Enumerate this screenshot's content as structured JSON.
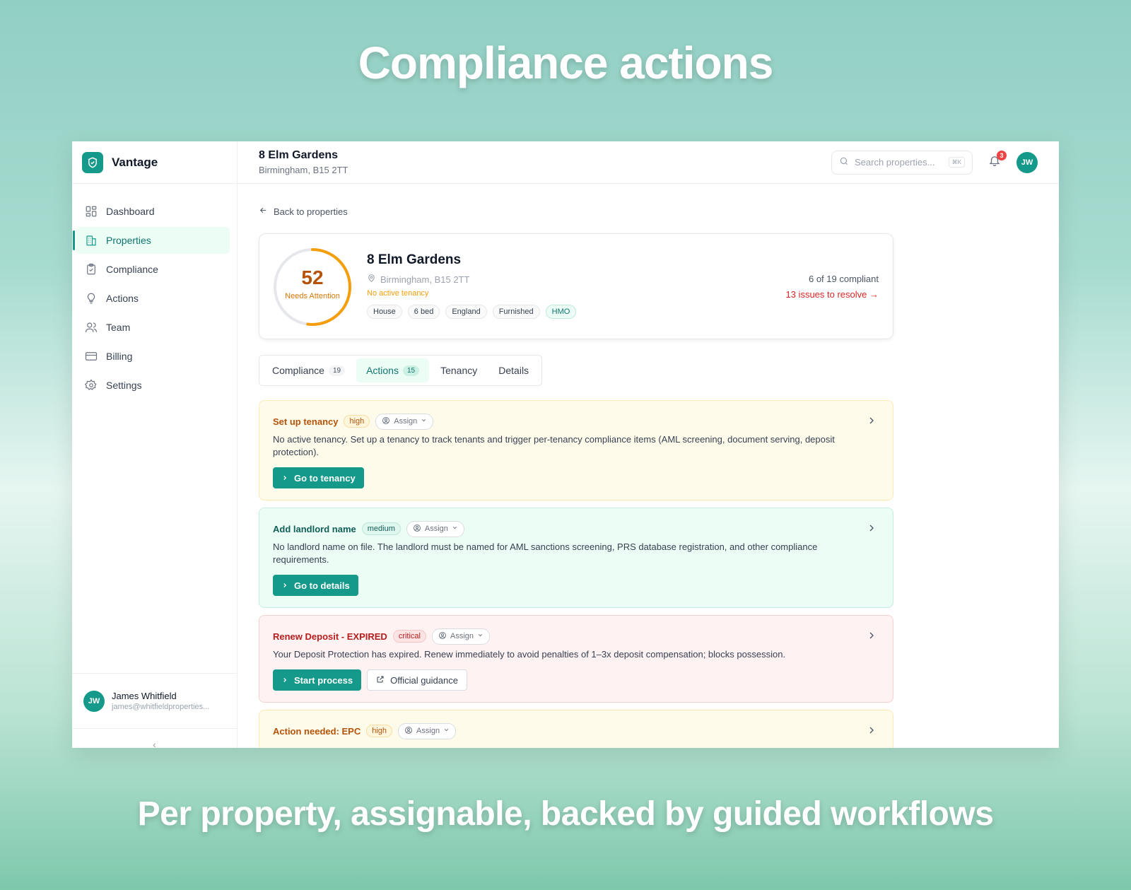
{
  "hero": {
    "title": "Compliance actions",
    "subtitle": "Per property, assignable, backed by guided workflows"
  },
  "app": {
    "brand": "Vantage",
    "nav": [
      {
        "label": "Dashboard",
        "icon": "grid-icon"
      },
      {
        "label": "Properties",
        "icon": "building-icon",
        "active": true
      },
      {
        "label": "Compliance",
        "icon": "clipboard-check-icon"
      },
      {
        "label": "Actions",
        "icon": "lightbulb-icon"
      },
      {
        "label": "Team",
        "icon": "users-icon"
      },
      {
        "label": "Billing",
        "icon": "credit-card-icon"
      },
      {
        "label": "Settings",
        "icon": "gear-icon"
      }
    ],
    "user": {
      "initials": "JW",
      "name": "James Whitfield",
      "email": "james@whitfieldproperties..."
    }
  },
  "topbar": {
    "title": "8 Elm Gardens",
    "subtitle": "Birmingham, B15 2TT",
    "search_placeholder": "Search properties...",
    "search_shortcut": "⌘K",
    "notification_count": "3",
    "avatar_initials": "JW"
  },
  "back_link": "Back to properties",
  "property": {
    "score": "52",
    "score_fraction": 0.52,
    "score_label": "Needs Attention",
    "name": "8 Elm Gardens",
    "location": "Birmingham, B15 2TT",
    "tenancy_status": "No active tenancy",
    "tags": [
      "House",
      "6 bed",
      "England",
      "Furnished",
      "HMO"
    ],
    "compliant_summary": "6 of 19 compliant",
    "issues_link": "13 issues to resolve →"
  },
  "tabs": [
    {
      "label": "Compliance",
      "count": "19"
    },
    {
      "label": "Actions",
      "count": "15",
      "active": true
    },
    {
      "label": "Tenancy"
    },
    {
      "label": "Details"
    }
  ],
  "actions": [
    {
      "title": "Set up tenancy",
      "priority": "high",
      "assign_label": "Assign",
      "description": "No active tenancy. Set up a tenancy to track tenants and trigger per-tenancy compliance items (AML screening, document serving, deposit protection).",
      "primary_button": "Go to tenancy"
    },
    {
      "title": "Add landlord name",
      "priority": "medium",
      "assign_label": "Assign",
      "description": "No landlord name on file. The landlord must be named for AML sanctions screening, PRS database registration, and other compliance requirements.",
      "primary_button": "Go to details"
    },
    {
      "title": "Renew Deposit - EXPIRED",
      "priority": "critical",
      "assign_label": "Assign",
      "description": "Your Deposit Protection has expired. Renew immediately to avoid penalties of 1–3x deposit compensation; blocks possession.",
      "primary_button": "Start process",
      "secondary_button": "Official guidance"
    },
    {
      "title": "Action needed: EPC",
      "priority": "high",
      "assign_label": "Assign"
    }
  ],
  "colors": {
    "accent": "#14998a",
    "high": "#b45309",
    "medium": "#0f5f57",
    "critical": "#b91c1c",
    "gauge": "#f59e0b"
  }
}
